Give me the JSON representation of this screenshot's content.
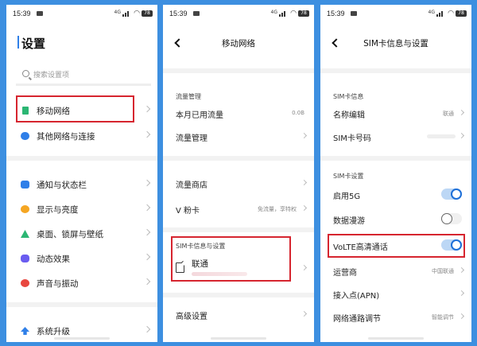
{
  "status_bar": {
    "time": "15:39",
    "signal": "4G",
    "battery": "78"
  },
  "screen1": {
    "title": "设置",
    "search_placeholder": "搜索设置项",
    "items": [
      {
        "label": "移动网络",
        "icon": "mobile-network-icon",
        "color": "#2bb673"
      },
      {
        "label": "其他网络与连接",
        "icon": "connection-icon",
        "color": "#2f7fe8"
      },
      {
        "label": "通知与状态栏",
        "icon": "notification-icon",
        "color": "#2f7fe8"
      },
      {
        "label": "显示与亮度",
        "icon": "display-icon",
        "color": "#f5a623"
      },
      {
        "label": "桌面、锁屏与壁纸",
        "icon": "wallpaper-icon",
        "color": "#2bb673"
      },
      {
        "label": "动态效果",
        "icon": "effects-icon",
        "color": "#6a5cf0"
      },
      {
        "label": "声音与振动",
        "icon": "sound-icon",
        "color": "#e8473f"
      },
      {
        "label": "系统升级",
        "icon": "upgrade-icon",
        "color": "#2f7fe8"
      }
    ]
  },
  "screen2": {
    "title": "移动网络",
    "section_traffic": "流量管理",
    "monthly_used_label": "本月已用流量",
    "monthly_used_value": "0.0B",
    "traffic_manage": "流量管理",
    "traffic_store": "流量商店",
    "vfans_label": "V 粉卡",
    "vfans_value": "免流量，享特权",
    "section_sim": "SIM卡信息与设置",
    "sim_carrier": "联通",
    "advanced": "高级设置"
  },
  "screen3": {
    "title": "SIM卡信息与设置",
    "section_info": "SIM卡信息",
    "name_edit_label": "名称编辑",
    "name_edit_value": "联通",
    "sim_number_label": "SIM卡号码",
    "section_settings": "SIM卡设置",
    "enable5g_label": "启用5G",
    "enable5g_on": true,
    "roaming_label": "数据漫游",
    "roaming_on": false,
    "volte_label": "VoLTE高清通话",
    "volte_on": true,
    "operator_label": "运营商",
    "operator_value": "中国联通",
    "apn_label": "接入点(APN)",
    "network_label": "网络通路调节",
    "network_value": "智能调节"
  },
  "highlight_color": "#d6252f",
  "accent_color": "#1d6fd8"
}
